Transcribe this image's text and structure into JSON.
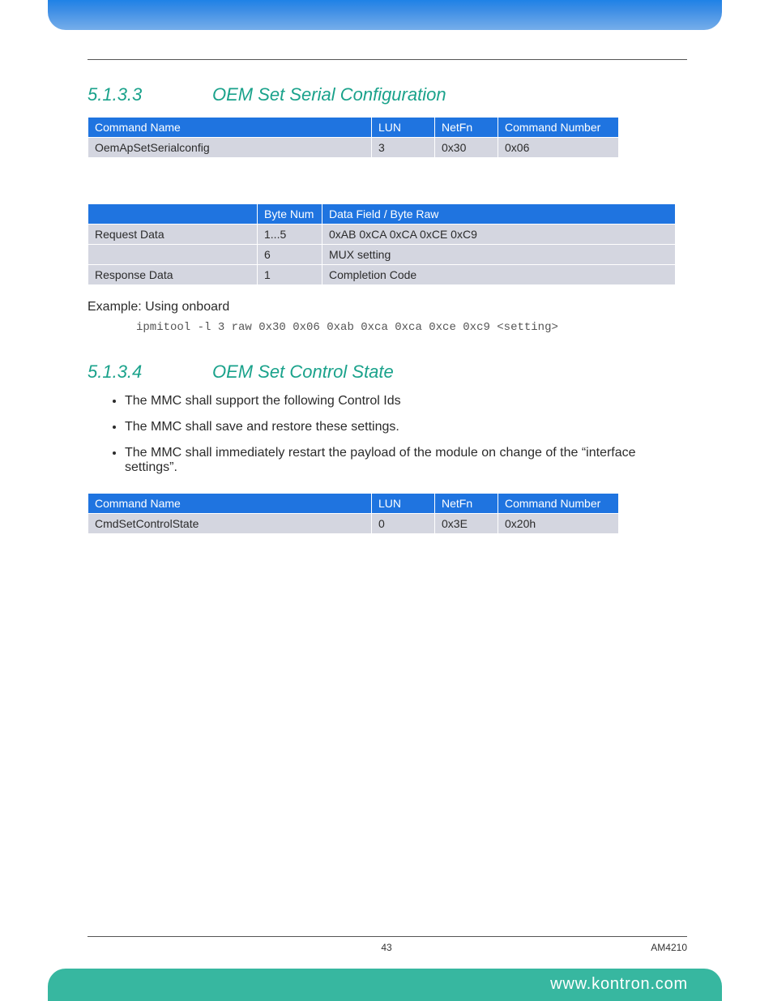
{
  "section_5133": {
    "number": "5.1.3.3",
    "title": "OEM Set Serial Configuration",
    "command_table": {
      "headers": [
        "Command Name",
        "LUN",
        "NetFn",
        "Command Number"
      ],
      "row": [
        "OemApSetSerialconfig",
        "3",
        "0x30",
        "0x06"
      ]
    },
    "data_table": {
      "headers": [
        "",
        "Byte Num",
        "Data Field / Byte Raw"
      ],
      "rows": [
        [
          "Request Data",
          "1...5",
          "0xAB 0xCA 0xCA 0xCE 0xC9"
        ],
        [
          "",
          "6",
          "MUX setting"
        ],
        [
          "Response Data",
          "1",
          "Completion Code"
        ]
      ]
    },
    "example_label": "Example: Using onboard",
    "example_cmd": "ipmitool -l 3 raw 0x30 0x06 0xab 0xca 0xca 0xce 0xc9 <setting>"
  },
  "section_5134": {
    "number": "5.1.3.4",
    "title": "OEM Set Control State",
    "bullets": [
      "The MMC shall support the following Control Ids",
      "The MMC shall save and restore these settings.",
      "The MMC shall immediately restart the payload of the module on change of the “interface settings”."
    ],
    "command_table": {
      "headers": [
        "Command Name",
        "LUN",
        "NetFn",
        "Command Number"
      ],
      "row": [
        "CmdSetControlState",
        "0",
        "0x3E",
        "0x20h"
      ]
    }
  },
  "footer": {
    "page": "43",
    "doc_id": "AM4210",
    "url": "www.kontron.com"
  }
}
